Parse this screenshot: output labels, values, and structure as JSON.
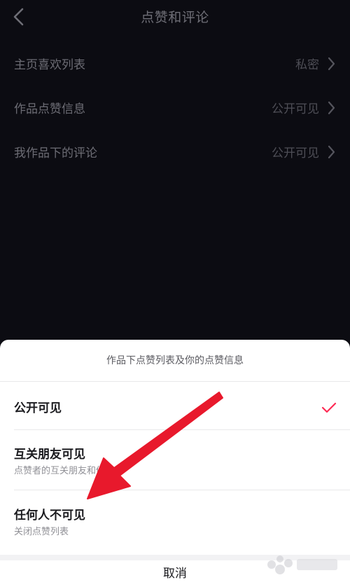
{
  "nav": {
    "title": "点赞和评论"
  },
  "settings": [
    {
      "label": "主页喜欢列表",
      "value": "私密"
    },
    {
      "label": "作品点赞信息",
      "value": "公开可见"
    },
    {
      "label": "我作品下的评论",
      "value": "公开可见"
    }
  ],
  "sheet": {
    "title": "作品下点赞列表及你的点赞信息",
    "options": [
      {
        "label": "公开可见",
        "subtitle": "",
        "selected": true
      },
      {
        "label": "互关朋友可见",
        "subtitle": "点赞者的互关朋友和你可见",
        "selected": false
      },
      {
        "label": "任何人不可见",
        "subtitle": "关闭点赞列表",
        "selected": false
      }
    ],
    "cancel": "取消"
  },
  "colors": {
    "accent": "#fe2c55",
    "annotation_arrow": "#e8192c",
    "background": "#0c0c12"
  },
  "icons": [
    "back-icon",
    "chevron-right-icon",
    "checkmark-icon"
  ]
}
